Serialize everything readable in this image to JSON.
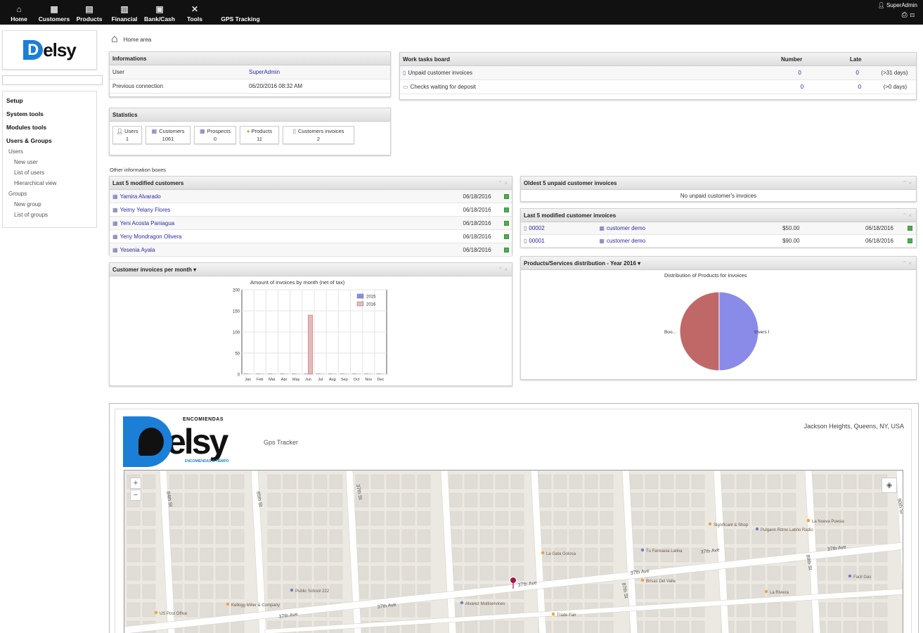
{
  "topmenu": {
    "items": [
      "Home",
      "Customers",
      "Products",
      "Financial",
      "Bank/Cash",
      "Tools",
      "GPS Tracking"
    ],
    "user": "SuperAdmin"
  },
  "left": {
    "menu": {
      "setup": "Setup",
      "system_tools": "System tools",
      "modules_tools": "Modules tools",
      "users_groups": "Users & Groups",
      "users": "Users",
      "new_user": "New user",
      "list_users": "List of users",
      "hierarchical": "Hierarchical view",
      "groups": "Groups",
      "new_group": "New group",
      "list_groups": "List of groups"
    }
  },
  "home": {
    "title": "Home area"
  },
  "info": {
    "header": "Informations",
    "user_label": "User",
    "user_value": "SuperAdmin",
    "prev_label": "Previous connection",
    "prev_value": "06/20/2016 08:32 AM"
  },
  "work": {
    "header": "Work tasks board",
    "col_number": "Number",
    "col_late": "Late",
    "rows": [
      {
        "label": "Unpaid customer invoices",
        "number": "0",
        "late": "0",
        "note": "(>31 days)"
      },
      {
        "label": "Checks waiting for deposit",
        "number": "0",
        "late": "0",
        "note": "(>0 days)"
      }
    ]
  },
  "stats": {
    "header": "Statistics",
    "tiles": [
      {
        "label": "Users",
        "value": "1"
      },
      {
        "label": "Customers",
        "value": "1061"
      },
      {
        "label": "Prospects",
        "value": "0"
      },
      {
        "label": "Products",
        "value": "11"
      },
      {
        "label": "Customers invoices",
        "value": "2"
      }
    ]
  },
  "other_info": "Other information boxes",
  "last_customers": {
    "header": "Last 5 modified customers",
    "rows": [
      {
        "name": "Yamira Alvarado",
        "date": "06/18/2016"
      },
      {
        "name": "Yeimy Yelany Flores",
        "date": "06/18/2016"
      },
      {
        "name": "Yeni Acosta Paniagua",
        "date": "06/18/2016"
      },
      {
        "name": "Yeny Mondragon Olivera",
        "date": "06/18/2016"
      },
      {
        "name": "Yesenia Ayala",
        "date": "06/18/2016"
      }
    ]
  },
  "oldest_unpaid": {
    "header": "Oldest 5 unpaid customer invoices",
    "empty": "No unpaid customer's invoices"
  },
  "last_invoices": {
    "header": "Last 5 modified customer invoices",
    "rows": [
      {
        "ref": "00002",
        "customer": "customer demo",
        "amount": "$50.00",
        "date": "06/18/2016"
      },
      {
        "ref": "00001",
        "customer": "customer demo",
        "amount": "$90.00",
        "date": "06/18/2016"
      }
    ]
  },
  "invoices_chart_box": {
    "header": "Customer invoices per month"
  },
  "products_box": {
    "header": "Products/Services distribution - Year 2016"
  },
  "chart_data": [
    {
      "type": "bar",
      "title": "Amount of invoices by month (net of tax)",
      "categories": [
        "Jan",
        "Feb",
        "Mar",
        "Apr",
        "May",
        "Jun",
        "Jul",
        "Aug",
        "Sep",
        "Oct",
        "Nov",
        "Dec"
      ],
      "series": [
        {
          "name": "2015",
          "values": [
            0,
            0,
            0,
            0,
            0,
            0,
            0,
            0,
            0,
            0,
            0,
            0
          ],
          "color": "#8a8ae8"
        },
        {
          "name": "2016",
          "values": [
            0,
            0,
            0,
            0,
            0,
            140,
            0,
            0,
            0,
            0,
            0,
            0
          ],
          "color": "#e8b8b8"
        }
      ],
      "yticks": [
        "0",
        "50",
        "100",
        "150",
        "200"
      ],
      "ylim": [
        0,
        200
      ],
      "grid": true,
      "legend": "top-right"
    },
    {
      "type": "pie",
      "title": "Distribution of Products for invoices",
      "slices": [
        {
          "label": "Boo...",
          "value": 50,
          "color": "#c06868"
        },
        {
          "label": "Invers I",
          "value": 50,
          "color": "#8a8ae8"
        }
      ]
    }
  ],
  "gps": {
    "brand_top": "ENCOMIENDAS",
    "brand_name": "elsy",
    "brand_bottom": "ENCOMIENDAS A TIEMPO",
    "tracker": "Gps Tracker",
    "location": "Jackson Heights, Queens, NY, USA"
  },
  "map": {
    "streets": [
      "37th Ave",
      "37th Ave",
      "37th Ave",
      "37th Ave",
      "37th Ave",
      "37th Ave",
      "84th St",
      "85th St",
      "37th St",
      "87th St",
      "89th St",
      "90th St"
    ],
    "places": [
      "Public School 222",
      "US Post Office",
      "Kellogg Miller & Company",
      "Alvarez Multiservices",
      "Trade Fair",
      "La Gata Golosa",
      "Tu Farmacia Latina",
      "Brisas Del Valle",
      "Significant & Shop",
      "Pulgarin Ritmo Latino Radio",
      "La Nueva Poesia",
      "La Riviera",
      "Facil Gas"
    ]
  }
}
